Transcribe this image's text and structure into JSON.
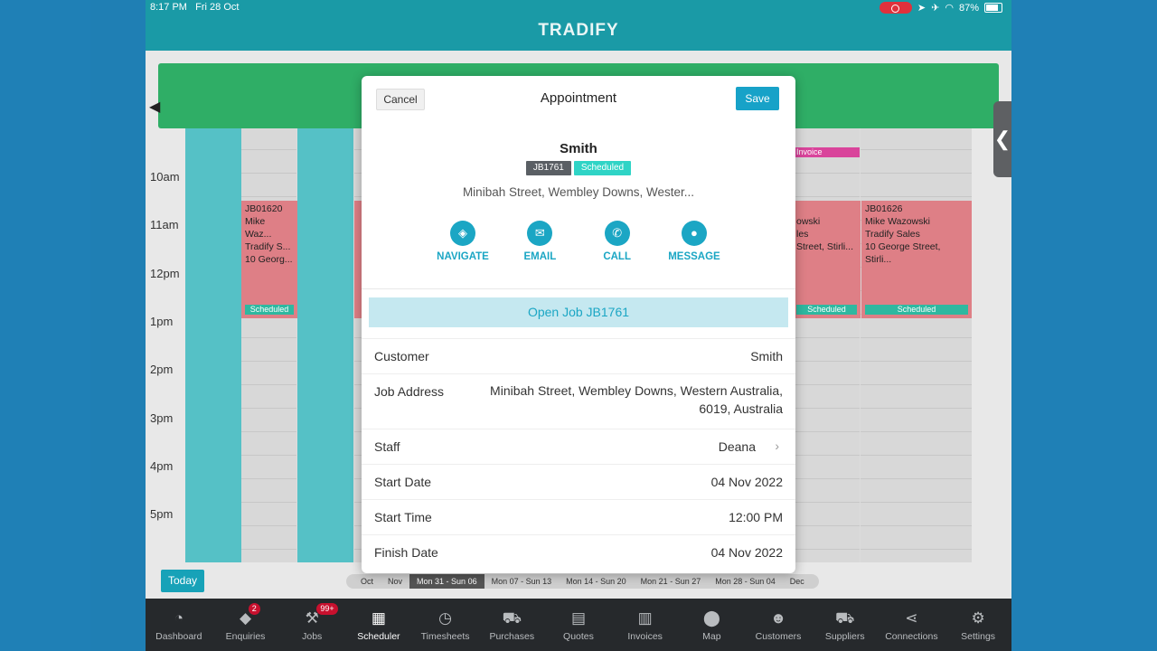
{
  "status": {
    "time": "8:17 PM",
    "date": "Fri 28 Oct",
    "battery": "87%"
  },
  "app": {
    "title": "TRADIFY"
  },
  "hours": [
    "10am",
    "11am",
    "12pm",
    "1pm",
    "2pm",
    "3pm",
    "4pm",
    "5pm"
  ],
  "calendar": {
    "left_job": {
      "code": "JB01620",
      "client": "Mike Waz...",
      "company": "Tradify S...",
      "address": "10 Georg...",
      "status": "Scheduled"
    },
    "right_partial": {
      "client": "owski",
      "company": "les",
      "address": "Street, Stirli...",
      "status": "Scheduled",
      "invoice": "Invoice"
    },
    "right_job": {
      "code": "JB01626",
      "client": "Mike Wazowski",
      "company": "Tradify Sales",
      "address": "10 George Street, Stirli...",
      "status": "Scheduled"
    }
  },
  "toolbar": {
    "today": "Today",
    "weeks": [
      "Oct",
      "Nov",
      "Mon 31 - Sun 06",
      "Mon 07 - Sun 13",
      "Mon 14 - Sun 20",
      "Mon 21 - Sun 27",
      "Mon 28 - Sun 04",
      "Dec"
    ]
  },
  "tabs": [
    {
      "label": "Dashboard",
      "icon": "dashboard-icon"
    },
    {
      "label": "Enquiries",
      "icon": "tags-icon",
      "badge": "2"
    },
    {
      "label": "Jobs",
      "icon": "hammer-icon",
      "badge": "99+"
    },
    {
      "label": "Scheduler",
      "icon": "calendar-icon"
    },
    {
      "label": "Timesheets",
      "icon": "clock-icon"
    },
    {
      "label": "Purchases",
      "icon": "cart-icon"
    },
    {
      "label": "Quotes",
      "icon": "calculator-icon"
    },
    {
      "label": "Invoices",
      "icon": "invoice-icon"
    },
    {
      "label": "Map",
      "icon": "map-pin-icon"
    },
    {
      "label": "Customers",
      "icon": "people-icon"
    },
    {
      "label": "Suppliers",
      "icon": "truck-icon"
    },
    {
      "label": "Connections",
      "icon": "share-icon"
    },
    {
      "label": "Settings",
      "icon": "gear-icon"
    }
  ],
  "modal": {
    "cancel": "Cancel",
    "title": "Appointment",
    "save": "Save",
    "name": "Smith",
    "job_no": "JB1761",
    "status": "Scheduled",
    "address_short": "Minibah Street, Wembley Downs, Wester...",
    "actions": {
      "navigate": "NAVIGATE",
      "email": "EMAIL",
      "call": "CALL",
      "message": "MESSAGE"
    },
    "open_job": "Open Job JB1761",
    "fields": {
      "customer_label": "Customer",
      "customer": "Smith",
      "address_label": "Job Address",
      "address": "Minibah Street, Wembley Downs, Western Australia, 6019, Australia",
      "staff_label": "Staff",
      "staff": "Deana",
      "start_date_label": "Start Date",
      "start_date": "04 Nov 2022",
      "start_time_label": "Start Time",
      "start_time": "12:00 PM",
      "finish_date_label": "Finish Date",
      "finish_date": "04 Nov 2022"
    }
  },
  "colors": {
    "accent": "#1ba6c4",
    "header": "#1a9aa6",
    "green": "#2fae66",
    "job": "#de7f86"
  }
}
